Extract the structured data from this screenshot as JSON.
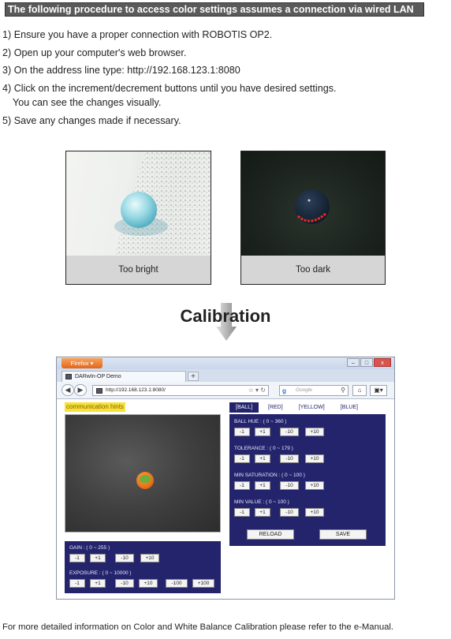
{
  "header": "The following procedure to access color settings assumes a connection via wired LAN",
  "steps": [
    "1) Ensure you have a proper connection with ROBOTIS OP2.",
    "2) Open up your computer's web browser.",
    "3) On the address line type: http://192.168.123.1:8080",
    "4) Click on the increment/decrement buttons until you have desired settings.",
    "You can see the changes visually.",
    "5) Save any changes made if necessary."
  ],
  "examples": {
    "bright_caption": "Too bright",
    "dark_caption": "Too dark"
  },
  "calibration_title": "Calibration",
  "browser": {
    "app_button": "Firefox",
    "tab_title": "DARwIn-OP Demo",
    "new_tab": "+",
    "url": "http://192.168.123.1:8080/",
    "search_placeholder": "Google",
    "search_engine_glyph": "g",
    "window_buttons": [
      "–",
      "□",
      "x"
    ]
  },
  "page": {
    "hints": "communication hints",
    "color_tabs": [
      "[BALL]",
      "[RED]",
      "[YELLOW]",
      "[BLUE]"
    ],
    "active_tab": "[BALL]",
    "right_panel": {
      "groups": [
        {
          "label": "BALL HUE : ( 0 ~ 360 )",
          "buttons": [
            "-1",
            "+1",
            "-10",
            "+10"
          ]
        },
        {
          "label": "TOLERANCE : ( 0 ~ 179 )",
          "buttons": [
            "-1",
            "+1",
            "-10",
            "+10"
          ]
        },
        {
          "label": "MIN SATURATION : ( 0 ~ 100 )",
          "buttons": [
            "-1",
            "+1",
            "-10",
            "+10"
          ]
        },
        {
          "label": "MIN VALUE : ( 0 ~ 100 )",
          "buttons": [
            "-1",
            "+1",
            "-10",
            "+10"
          ]
        }
      ],
      "reload": "RELOAD",
      "save": "SAVE"
    },
    "left_panel": {
      "gain_label": "GAIN : ( 0 ~ 255 )",
      "gain_buttons": [
        "-1",
        "+1",
        "-10",
        "+10"
      ],
      "exposure_label": "EXPOSURE : ( 0 ~ 10000 )",
      "exposure_buttons": [
        "-1",
        "+1",
        "-10",
        "+10",
        "-100",
        "+100"
      ]
    }
  },
  "footer": "For more detailed information on Color and White Balance Calibration please refer to the e-Manual."
}
